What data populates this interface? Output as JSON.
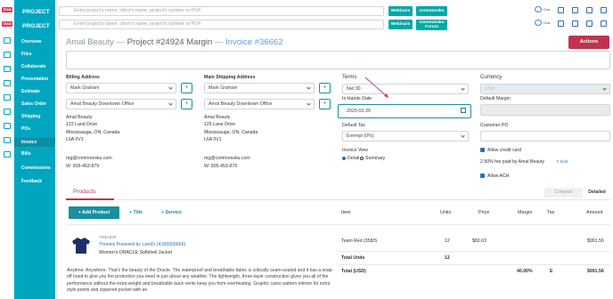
{
  "brand_label": "TEAM",
  "nav": {
    "project_label": "PROJECT",
    "project_label2": "PROJECT",
    "items": [
      "Overview",
      "Files",
      "Collaborate",
      "Presentation",
      "Estimate",
      "Sales Order",
      "Shipping",
      "POs",
      "Invoice",
      "Bills",
      "Commissions",
      "Feedback"
    ],
    "active": "Invoice"
  },
  "search": {
    "placeholder": "Enter project's name, client's name, project's number or PO#"
  },
  "topbar": {
    "webinars": "Webinars",
    "community": "commonsku",
    "community_forum_line1": "commonsku",
    "community_forum_line2": "Forum",
    "chat1": "Chat",
    "chat2": "Chat"
  },
  "title": {
    "client": "Amal Beauty",
    "project": "Project #24924 Margin",
    "invoice": "Invoice #36662",
    "dash": "—"
  },
  "actions_label": "Actions",
  "billing": {
    "label": "Billing Address",
    "contact": "Mark Graham",
    "address_select": "Amal Beauty Downtown Office",
    "lines": [
      "Amal Beauty",
      "123 Land Drive",
      "Mississauga, ON, Canada",
      "L6A 0V1"
    ],
    "email": "mg@commonsku.com",
    "phone": "W: 905-453-879"
  },
  "shipping": {
    "label": "Main Shipping Address",
    "contact": "Mark Graham",
    "address_select": "Amal Beauty Downtown Office",
    "lines": [
      "Amal Beauty",
      "125 Lane Drive",
      "Mississauga, ON, Canada",
      "L6A 0V1"
    ],
    "email": "mg@commonsku.com",
    "phone": "W: 905-453-879"
  },
  "terms": {
    "label": "Terms",
    "value": "Net 30"
  },
  "in_hands": {
    "label": "In Hands Date",
    "value": "2025-02-26"
  },
  "default_tax": {
    "label": "Default Tax",
    "value": "Exempt (0%)"
  },
  "invoice_view": {
    "label": "Invoice View",
    "options": [
      "Detail",
      "Summary"
    ],
    "selected": "Detail"
  },
  "currency": {
    "label": "Currency",
    "value": "USD"
  },
  "default_margin": {
    "label": "Default Margin"
  },
  "customer_po": {
    "label": "Customer PO"
  },
  "credit": {
    "label": "Allow credit card",
    "fee": "2.50% fee paid by Amal Beauty",
    "edit": "Edit"
  },
  "ach": {
    "label": "Allow ACH"
  },
  "products": {
    "tab": "Products",
    "compact": "Compact",
    "detailed": "Detailed",
    "add_product": "+ Add Product",
    "add_title": "Title",
    "add_service": "Service",
    "columns": [
      "Item",
      "Units",
      "Price",
      "Margin",
      "Tax",
      "Amount"
    ]
  },
  "item": {
    "code": "TM91926",
    "supplier": "Thrivels Powered by Leed's (4165556666)",
    "name": "Women's ORACLE Softshell Jacket",
    "description": "Anytime. Anywhere. That's the beauty of the Oracle. The waterproof and breathable fabric is critically seam-sealed and it has a snap-off hood to give you the protection you need in just about any weather. The lightweight, three-layer construction gives you all of the performance without the extra weight and breathable back vents keep you from overheating. Graphic camo pattern interior for extra style points and zippered pocket with an",
    "variant": "Team Red (358/S",
    "units": "12",
    "price": "$82.63",
    "amount": "$991.56",
    "total_units_label": "Total Units",
    "total_units": "12",
    "total_label": "Total (USD)",
    "total_margin": "40.00%",
    "total_tax": "E",
    "total_amount": "$991.56"
  },
  "colors": {
    "teal": "#00a6c0",
    "accent": "#c0334e",
    "button": "#00a9a7"
  }
}
